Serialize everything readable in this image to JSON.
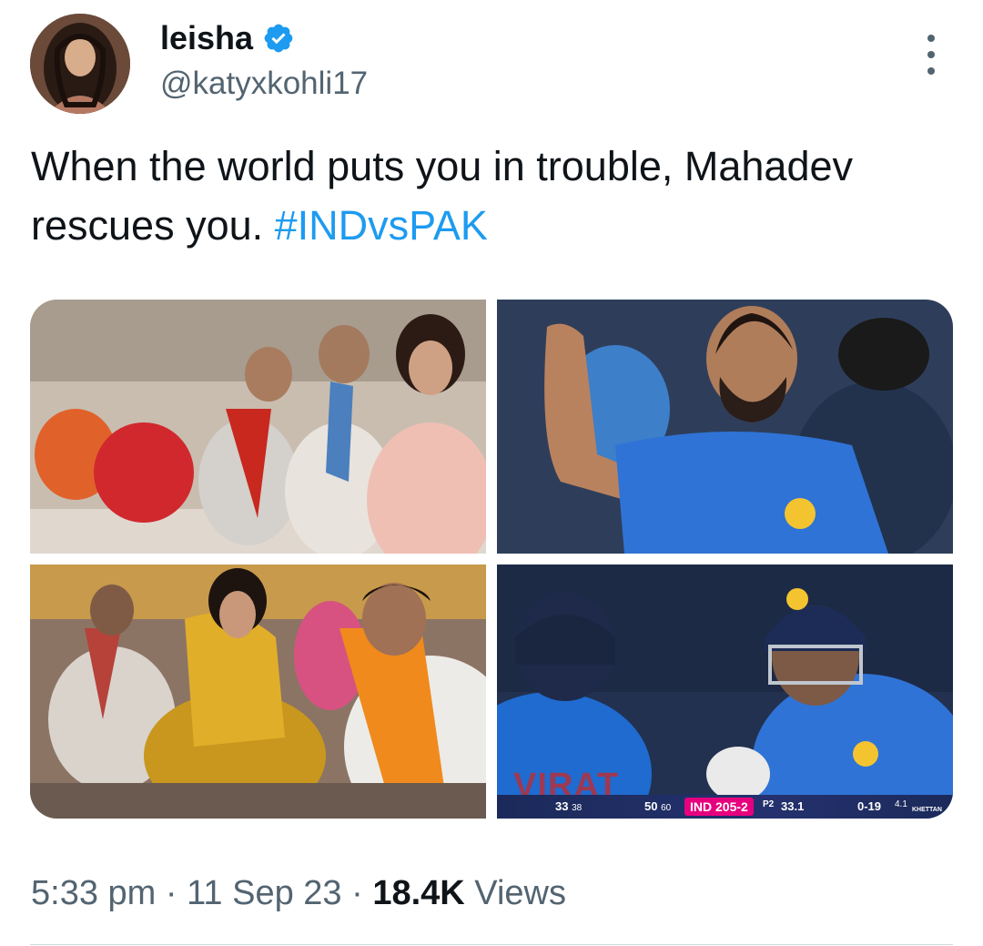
{
  "user": {
    "display_name": "leisha",
    "handle": "@katyxkohli17",
    "verified": true,
    "avatar_icon": "profile-photo"
  },
  "tweet": {
    "text": "When the world puts you in trouble, Mahadev rescues you. ",
    "hashtag": "#INDvsPAK"
  },
  "scoreboard": {
    "batter1_runs": "33",
    "batter1_balls": "38",
    "batter2_runs": "50",
    "batter2_balls": "60",
    "score": "IND 205-2",
    "phase": "P2",
    "overs": "33.1",
    "bowler_figures": "0-19",
    "bowler_overs": "4.1",
    "bowler_name": "KHETTAN",
    "jersey_name": "VIRAT"
  },
  "meta": {
    "time": "5:33 pm",
    "date": "11 Sep 23",
    "views_count": "18.4K",
    "views_label": "Views",
    "separator": "·"
  },
  "colors": {
    "accent": "#1d9bf0",
    "secondary_text": "#536471",
    "primary_text": "#0f1419",
    "divider": "#cfd9de"
  }
}
